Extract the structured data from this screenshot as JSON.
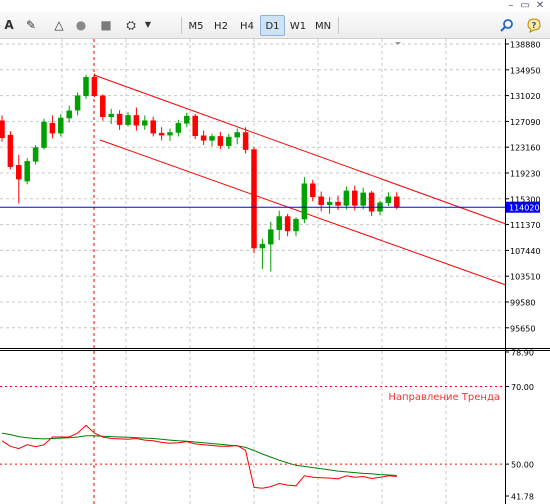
{
  "window_controls": {
    "minimize": "–",
    "restore": "▭",
    "close": "✕"
  },
  "toolbar": {
    "tools": [
      {
        "name": "text-tool-icon",
        "glyph": "A"
      },
      {
        "name": "pencil-tool-icon",
        "glyph": "✎"
      },
      {
        "name": "triangle-tool-icon",
        "glyph": "△"
      },
      {
        "name": "ellipse-tool-icon",
        "glyph": "●"
      },
      {
        "name": "rectangle-tool-icon",
        "glyph": "■"
      },
      {
        "name": "shapes-dropdown-icon",
        "glyph": "⛭"
      }
    ],
    "timeframes": [
      "M5",
      "H2",
      "H4",
      "D1",
      "W1",
      "MN"
    ],
    "active_timeframe": "D1",
    "search_icon": "search-icon",
    "help_icon": "help-icon"
  },
  "chart_data": [
    {
      "type": "candlestick",
      "price_axis_labels": [
        "138880",
        "134950",
        "131020",
        "127090",
        "123160",
        "119230",
        "115300",
        "111370",
        "107440",
        "103510",
        "99580",
        "95650"
      ],
      "current_price": "114020",
      "colors": {
        "bull": "#00a000",
        "bear": "#ff0000",
        "price_line": "#0000ff",
        "trend_channel": "#ff0000",
        "grid": "#c8c8c8",
        "vertical_marker": "#ff0000"
      },
      "trend_channel": "descending"
    },
    {
      "type": "line",
      "indicator_label": "Направление Тренда",
      "axis_labels": [
        "78.90",
        "70.00",
        "50.00",
        "41.78"
      ],
      "levels": [
        70,
        50
      ],
      "series": [
        {
          "color": "#ff0000"
        },
        {
          "color": "#008000"
        }
      ]
    }
  ]
}
